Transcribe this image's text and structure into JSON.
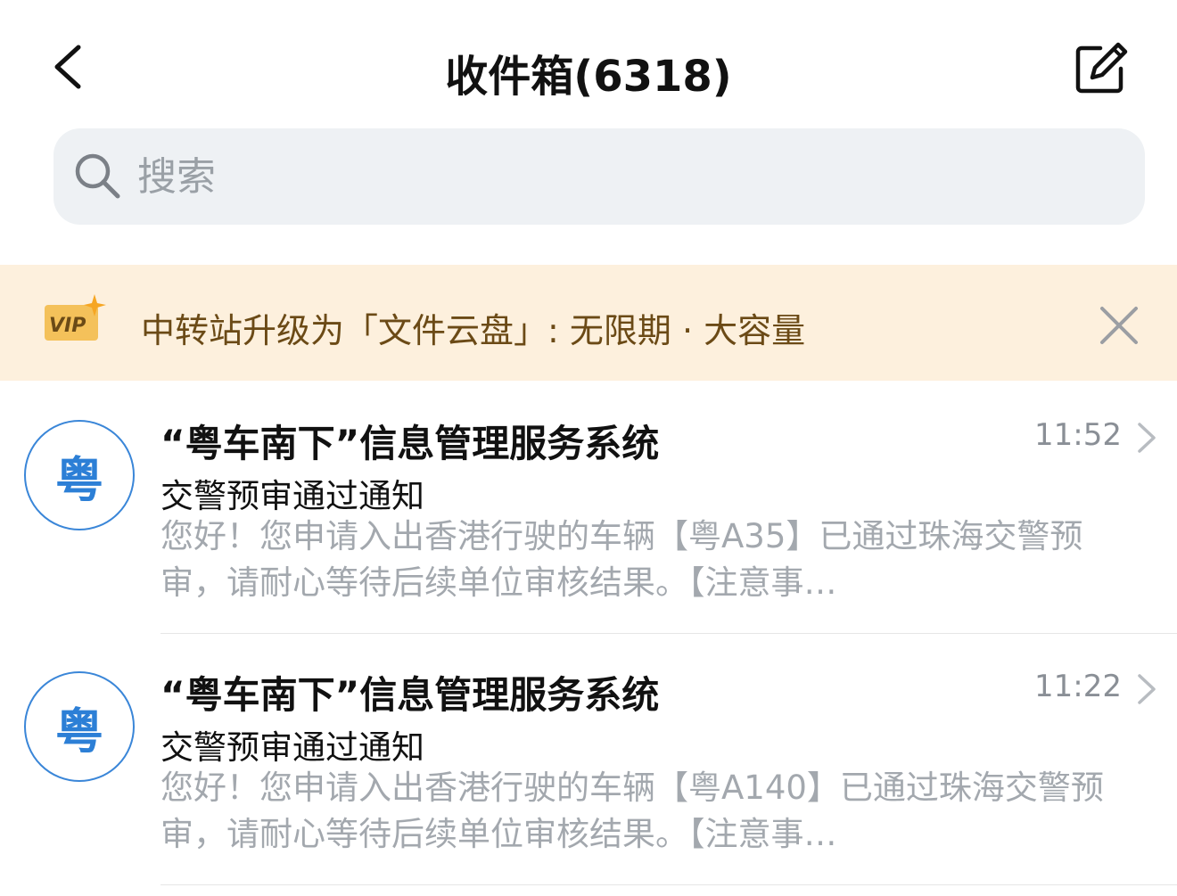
{
  "header": {
    "title": "收件箱(6318)",
    "back_icon": "chevron-left-icon",
    "compose_icon": "compose-icon"
  },
  "search": {
    "placeholder": "搜索",
    "icon": "search-icon"
  },
  "banner": {
    "badge": "VIP",
    "text": "中转站升级为「文件云盘」: 无限期 · 大容量",
    "close_icon": "close-icon",
    "background": "#fdf0dd"
  },
  "mails": [
    {
      "avatar": "粤",
      "sender": "“粤车南下”信息管理服务系统",
      "time": "11:52",
      "subject": "交警预审通过通知",
      "preview": "您好！您申请入出香港行驶的车辆【粤A35】已通过珠海交警预审，请耐心等待后续单位审核结果。【注意事…"
    },
    {
      "avatar": "粤",
      "sender": "“粤车南下”信息管理服务系统",
      "time": "11:22",
      "subject": "交警预审通过通知",
      "preview": "您好！您申请入出香港行驶的车辆【粤A140】已通过珠海交警预审，请耐心等待后续单位审核结果。【注意事…"
    }
  ],
  "colors": {
    "accent": "#2c7fd6",
    "muted_text": "#a3a8ae",
    "search_bg": "#eef1f4"
  }
}
